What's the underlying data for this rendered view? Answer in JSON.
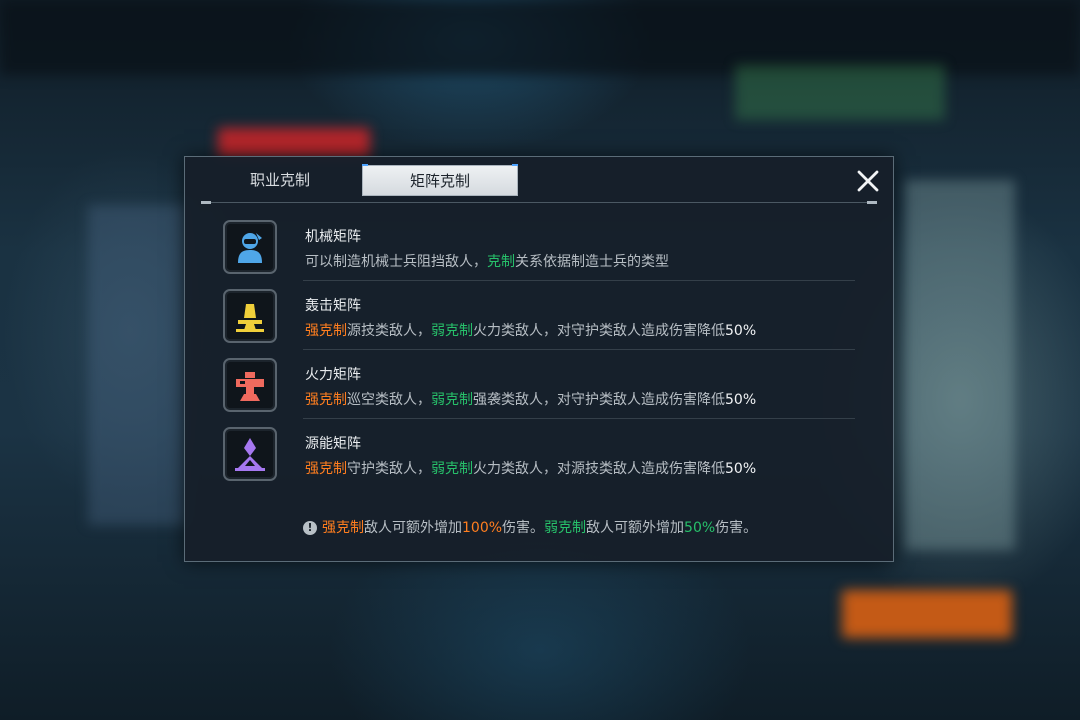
{
  "tabs": [
    {
      "label": "职业克制",
      "active": false
    },
    {
      "label": "矩阵克制",
      "active": true
    }
  ],
  "close_icon": "close-icon",
  "rows": [
    {
      "title": "机械矩阵",
      "icon": "mech-matrix-icon",
      "icon_color": "#4fa6e8",
      "desc": {
        "a": "可以制造机械士兵阻挡敌人，",
        "b": "克制",
        "c": "关系依据制造士兵的类型"
      }
    },
    {
      "title": "轰击矩阵",
      "icon": "bombard-matrix-icon",
      "icon_color": "#f0cf3a",
      "desc": {
        "strong": "强克制",
        "a": "源技类敌人，",
        "weak": "弱克制",
        "b": "火力类敌人，对守护类敌人造成伤害降低",
        "pct": "50%"
      }
    },
    {
      "title": "火力矩阵",
      "icon": "firepower-matrix-icon",
      "icon_color": "#ef6a5e",
      "desc": {
        "strong": "强克制",
        "a": "巡空类敌人，",
        "weak": "弱克制",
        "b": "强袭类敌人，对守护类敌人造成伤害降低",
        "pct": "50%"
      }
    },
    {
      "title": "源能矩阵",
      "icon": "source-energy-matrix-icon",
      "icon_color": "#a678f0",
      "desc": {
        "strong": "强克制",
        "a": "守护类敌人，",
        "weak": "弱克制",
        "b": "火力类敌人，对源技类敌人造成伤害降低",
        "pct": "50%"
      }
    }
  ],
  "footer": {
    "icon": "warning-icon",
    "icon_glyph": "!",
    "strong": "强克制",
    "a": "敌人可额外增加",
    "strong_pct": "100%",
    "b": "伤害。",
    "weak": "弱克制",
    "c": "敌人可额外增加",
    "weak_pct": "50%",
    "d": "伤害。"
  },
  "colors": {
    "strong": "#ff7e1f",
    "weak": "#27c06a",
    "panel_bg": "#161f29"
  }
}
